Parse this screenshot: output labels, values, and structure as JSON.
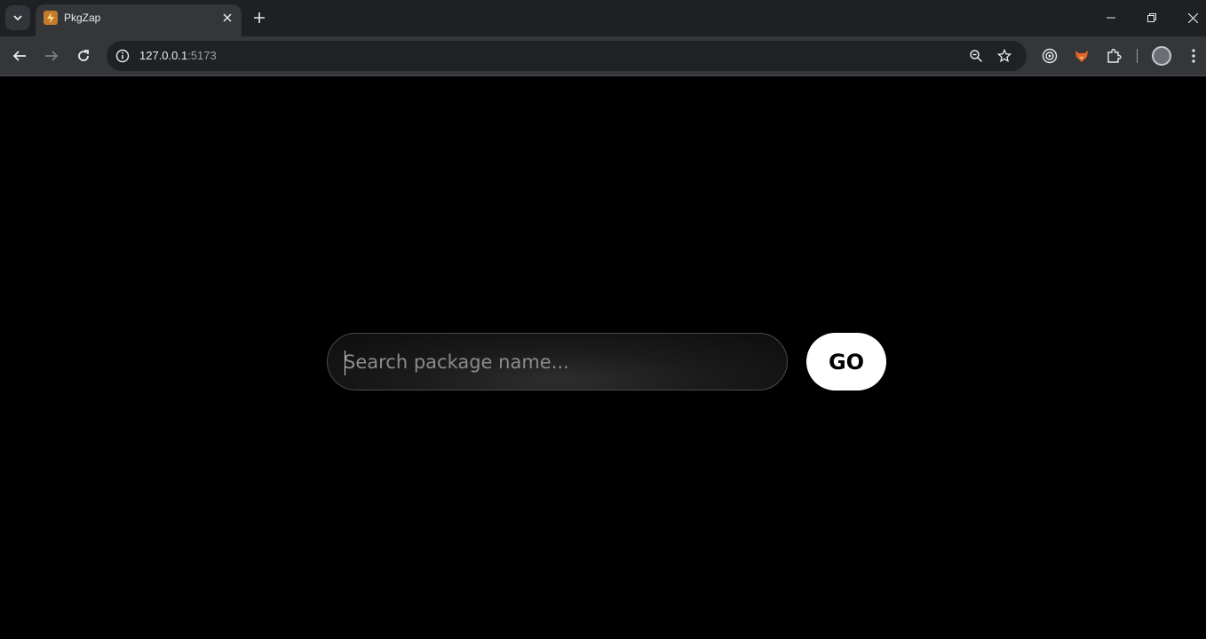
{
  "browser": {
    "tab": {
      "title": "PkgZap",
      "favicon": "lightning-bolt-icon"
    },
    "address": {
      "host": "127.0.0.1",
      "port": ":5173"
    }
  },
  "page": {
    "search": {
      "placeholder": "Search package name...",
      "value": ""
    },
    "go_button": {
      "label": "GO"
    }
  },
  "colors": {
    "page_background": "#000000",
    "button_background": "#ffffff",
    "button_text": "#000000",
    "favicon_accent": "#c47a2c"
  }
}
